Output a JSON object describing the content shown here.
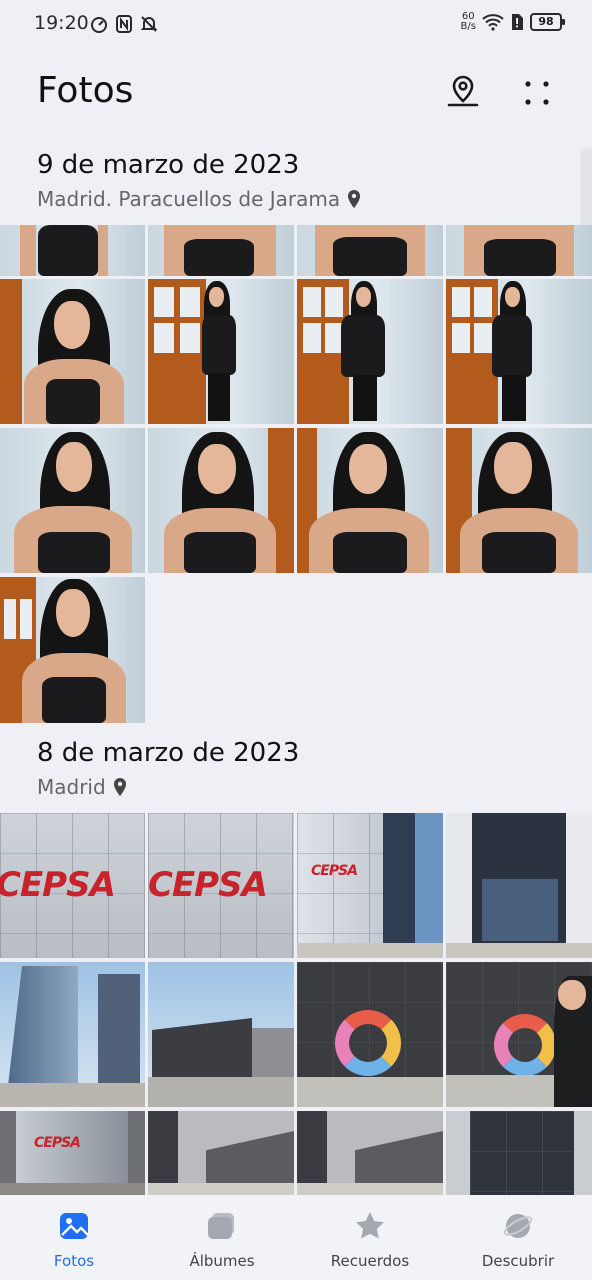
{
  "status": {
    "time": "19:20",
    "net_speed_value": "60",
    "net_speed_unit": "B/s",
    "battery": "98"
  },
  "header": {
    "title": "Fotos"
  },
  "sections": [
    {
      "date": "9 de marzo de 2023",
      "location": "Madrid. Paracuellos de Jarama"
    },
    {
      "date": "8 de marzo de 2023",
      "location": "Madrid"
    }
  ],
  "cepsa_sign": "CEPSA",
  "nav": {
    "items": [
      {
        "label": "Fotos",
        "icon": "photo-icon",
        "active": true
      },
      {
        "label": "Álbumes",
        "icon": "albums-icon",
        "active": false
      },
      {
        "label": "Recuerdos",
        "icon": "star-icon",
        "active": false
      },
      {
        "label": "Descubrir",
        "icon": "planet-icon",
        "active": false
      }
    ]
  },
  "colors": {
    "accent": "#1f6ff2",
    "background": "#eef0f5",
    "brand_sign": "#c8232c"
  }
}
